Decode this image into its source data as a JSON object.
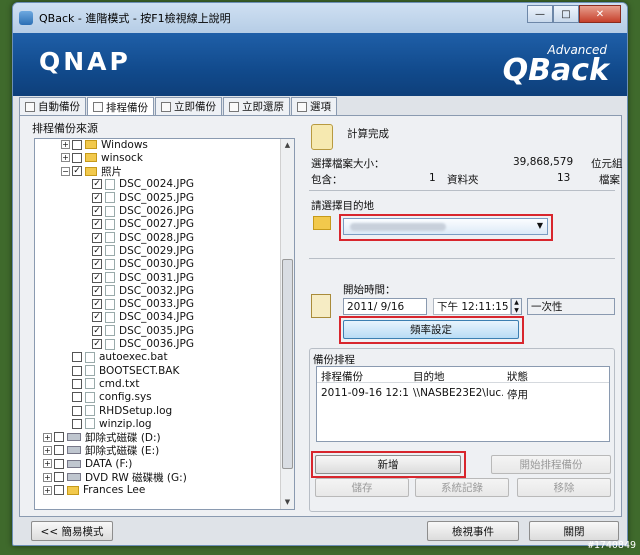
{
  "window": {
    "title": "QBack - 進階模式 - 按F1檢視線上說明",
    "controls": [
      "—",
      "□",
      "✕"
    ]
  },
  "banner": {
    "logo": "QNAP",
    "product": "QBack",
    "edition": "Advanced"
  },
  "tabs": [
    {
      "label": "自動備份"
    },
    {
      "label": "排程備份"
    },
    {
      "label": "立即備份"
    },
    {
      "label": "立即還原"
    },
    {
      "label": "選項"
    }
  ],
  "source": {
    "label": "排程備份來源",
    "tree": [
      {
        "label": "Windows",
        "kind": "folder",
        "checked": false,
        "depth": 1,
        "expander": "+"
      },
      {
        "label": "winsock",
        "kind": "folder",
        "checked": false,
        "depth": 1,
        "expander": "+"
      },
      {
        "label": "照片",
        "kind": "folder",
        "checked": true,
        "depth": 1,
        "expander": "−"
      },
      {
        "label": "DSC_0024.JPG",
        "kind": "file",
        "checked": true,
        "depth": 2
      },
      {
        "label": "DSC_0025.JPG",
        "kind": "file",
        "checked": true,
        "depth": 2
      },
      {
        "label": "DSC_0026.JPG",
        "kind": "file",
        "checked": true,
        "depth": 2
      },
      {
        "label": "DSC_0027.JPG",
        "kind": "file",
        "checked": true,
        "depth": 2
      },
      {
        "label": "DSC_0028.JPG",
        "kind": "file",
        "checked": true,
        "depth": 2
      },
      {
        "label": "DSC_0029.JPG",
        "kind": "file",
        "checked": true,
        "depth": 2
      },
      {
        "label": "DSC_0030.JPG",
        "kind": "file",
        "checked": true,
        "depth": 2
      },
      {
        "label": "DSC_0031.JPG",
        "kind": "file",
        "checked": true,
        "depth": 2
      },
      {
        "label": "DSC_0032.JPG",
        "kind": "file",
        "checked": true,
        "depth": 2
      },
      {
        "label": "DSC_0033.JPG",
        "kind": "file",
        "checked": true,
        "depth": 2
      },
      {
        "label": "DSC_0034.JPG",
        "kind": "file",
        "checked": true,
        "depth": 2
      },
      {
        "label": "DSC_0035.JPG",
        "kind": "file",
        "checked": true,
        "depth": 2
      },
      {
        "label": "DSC_0036.JPG",
        "kind": "file",
        "checked": true,
        "depth": 2
      },
      {
        "label": "autoexec.bat",
        "kind": "file",
        "checked": false,
        "depth": 1
      },
      {
        "label": "BOOTSECT.BAK",
        "kind": "file",
        "checked": false,
        "depth": 1
      },
      {
        "label": "cmd.txt",
        "kind": "file",
        "checked": false,
        "depth": 1
      },
      {
        "label": "config.sys",
        "kind": "file",
        "checked": false,
        "depth": 1
      },
      {
        "label": "RHDSetup.log",
        "kind": "file",
        "checked": false,
        "depth": 1
      },
      {
        "label": "winzip.log",
        "kind": "file",
        "checked": false,
        "depth": 1
      },
      {
        "label": "卸除式磁碟 (D:)",
        "kind": "drive",
        "checked": false,
        "depth": 0,
        "expander": "+"
      },
      {
        "label": "卸除式磁碟 (E:)",
        "kind": "drive",
        "checked": false,
        "depth": 0,
        "expander": "+"
      },
      {
        "label": "DATA (F:)",
        "kind": "drive",
        "checked": false,
        "depth": 0,
        "expander": "+"
      },
      {
        "label": "DVD RW 磁碟機 (G:)",
        "kind": "drive",
        "checked": false,
        "depth": 0,
        "expander": "+"
      },
      {
        "label": "Frances Lee",
        "kind": "folder",
        "checked": false,
        "depth": 0,
        "expander": "+"
      }
    ]
  },
  "summary": {
    "status": "計算完成",
    "size_label": "選擇檔案大小：",
    "size_value": "39,868,579",
    "size_unit": "位元組",
    "contains_label": "包含：",
    "folder_count": "1",
    "folder_unit": "資料夾",
    "file_count": "13",
    "file_unit": "檔案"
  },
  "destination": {
    "label": "請選擇目的地"
  },
  "schedule": {
    "start_label": "開始時間：",
    "date": "2011/ 9/16",
    "time": "下午 12:11:15",
    "once_label": "一次性",
    "freq_button": "頻率設定"
  },
  "jobs": {
    "group_label": "備份排程",
    "columns": [
      "排程備份",
      "目的地",
      "狀態"
    ],
    "rows": [
      {
        "schedule": "2011-09-16 12:1...",
        "dest": "\\\\NASBE23E2\\luc...",
        "status": "停用"
      }
    ],
    "buttons": {
      "add": "新增",
      "start": "開始排程備份",
      "save": "儲存",
      "log": "系統記錄",
      "remove": "移除"
    }
  },
  "footer": {
    "simple_mode": "<< 簡易模式",
    "view_events": "檢視事件",
    "close": "關閉"
  },
  "watermark": "#1740849"
}
